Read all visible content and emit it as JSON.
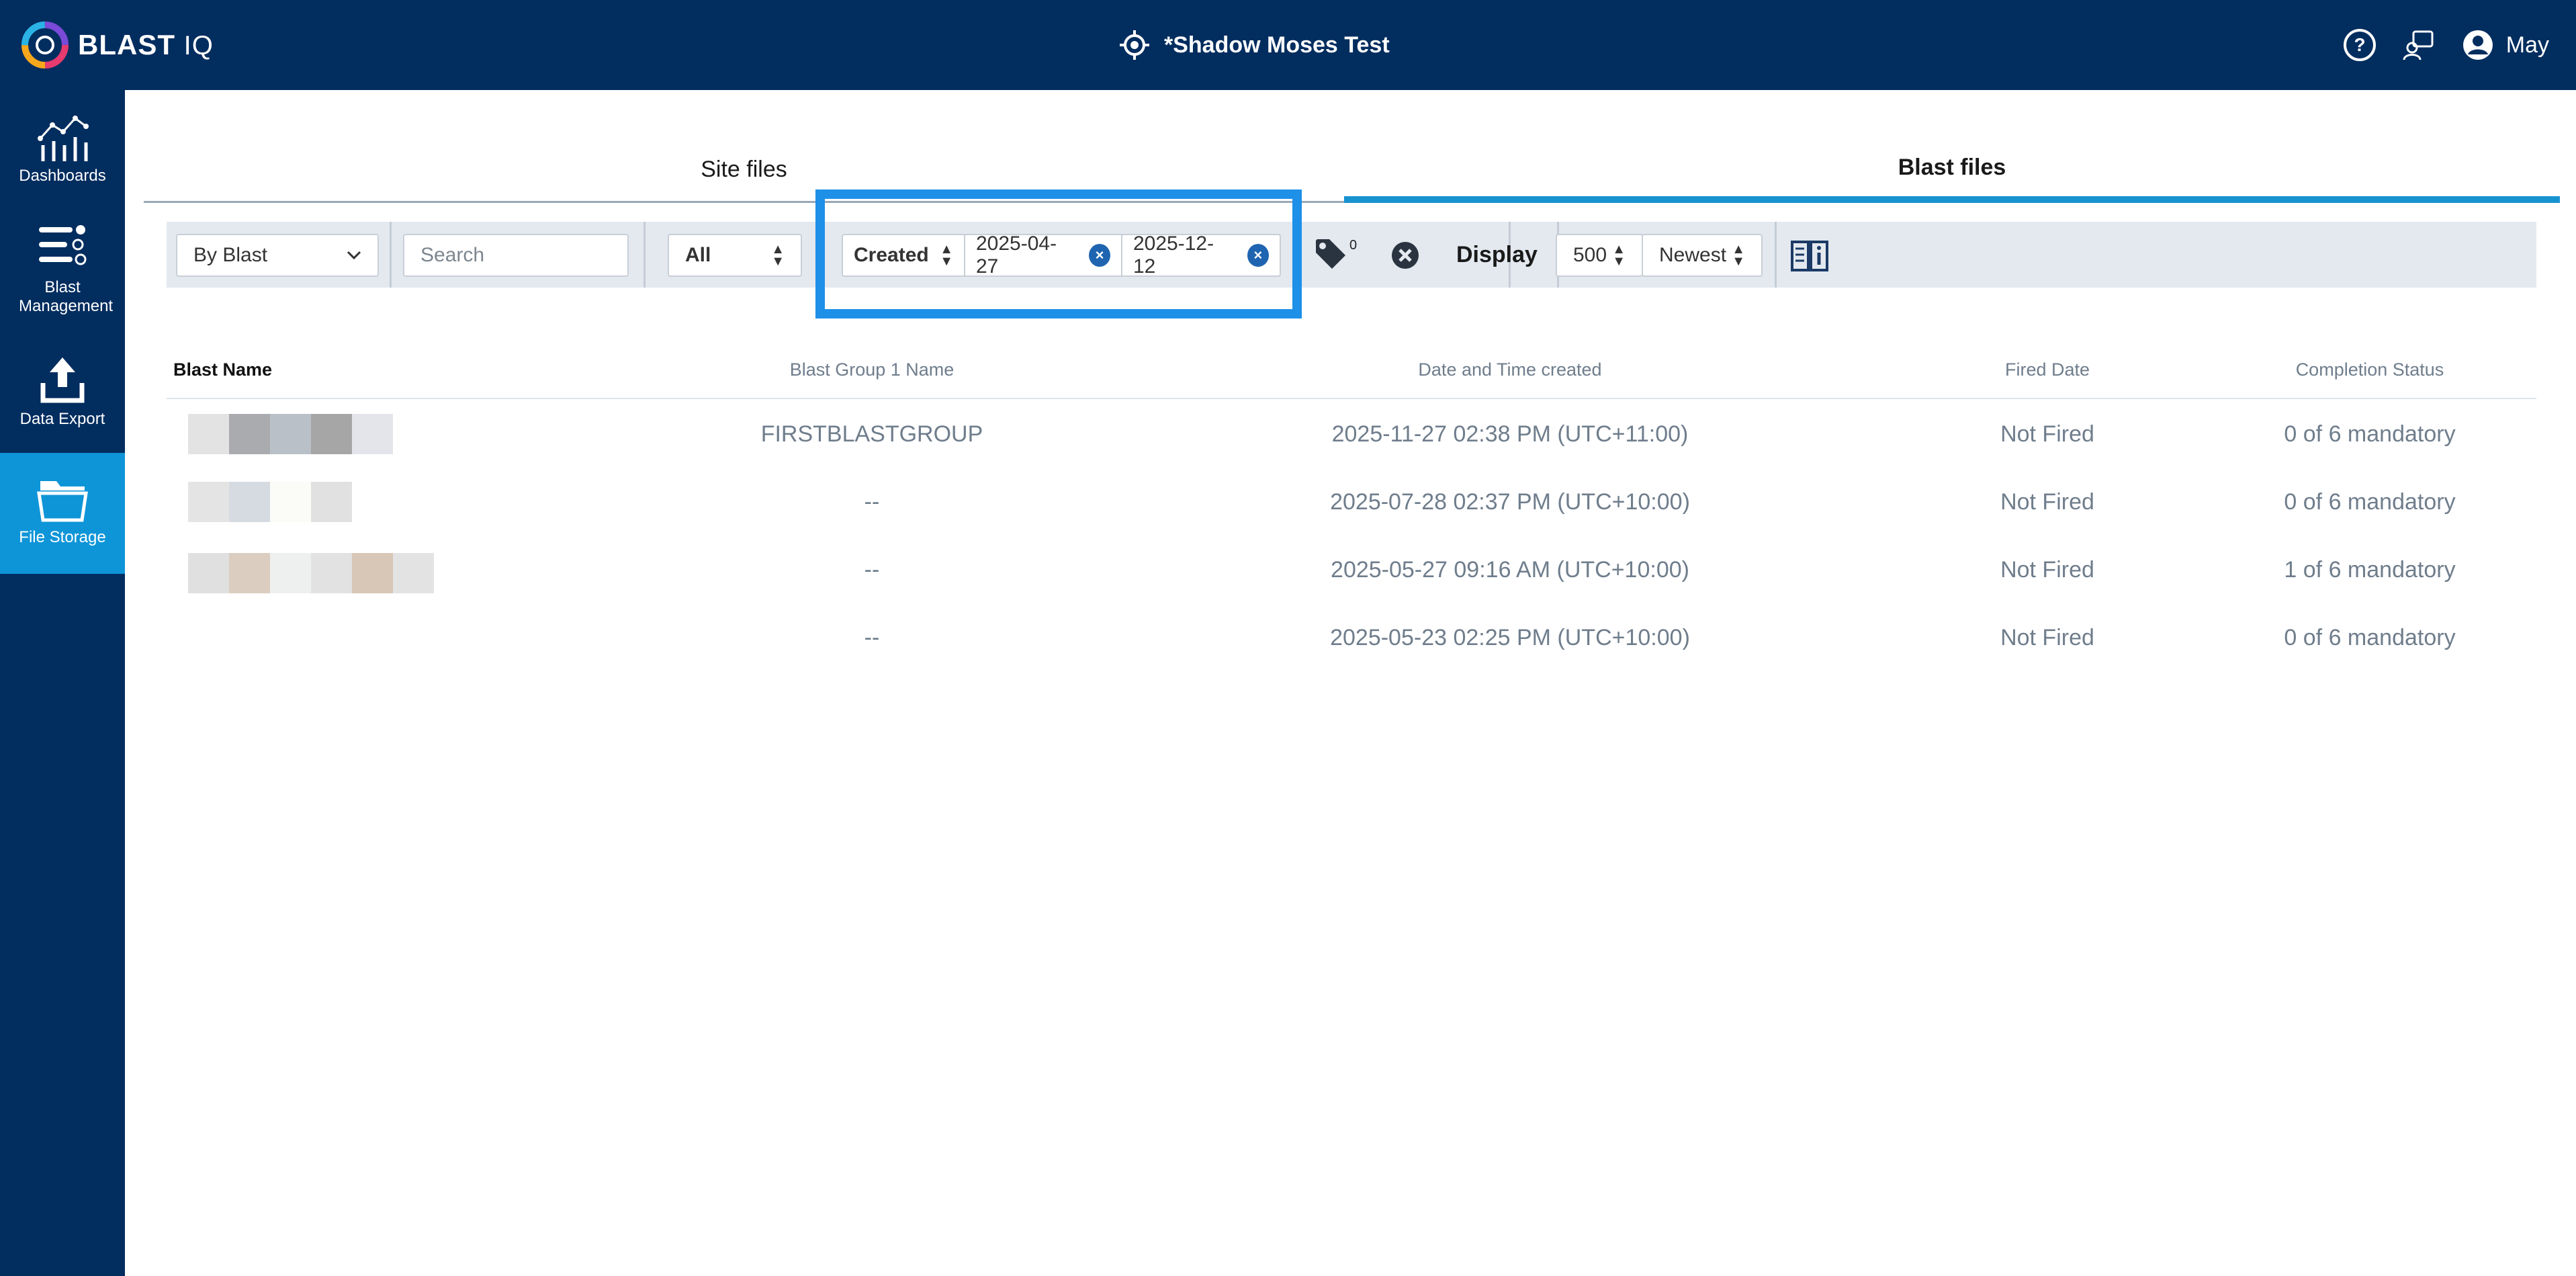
{
  "header": {
    "logo_text": "BLAST",
    "logo_suffix": "IQ",
    "site_title": "*Shadow Moses Test",
    "user_name": "May"
  },
  "sidebar": {
    "items": [
      {
        "label": "Dashboards",
        "icon": "dashboards-icon"
      },
      {
        "label": "Blast Management",
        "icon": "blast-management-icon"
      },
      {
        "label": "Data Export",
        "icon": "upload-icon"
      },
      {
        "label": "File Storage",
        "icon": "folder-icon",
        "active": true
      }
    ]
  },
  "tabs": [
    {
      "label": "Site files",
      "active": false
    },
    {
      "label": "Blast files",
      "active": true
    }
  ],
  "filters": {
    "group_by": "By Blast",
    "search_placeholder": "Search",
    "type_filter": "All",
    "date_field": "Created",
    "date_from": "2025-04-27",
    "date_to": "2025-12-12",
    "tag_count": "0",
    "display_label": "Display",
    "page_size": "500",
    "sort": "Newest"
  },
  "table": {
    "columns": [
      "Blast Name",
      "Blast Group 1 Name",
      "Date and Time created",
      "Fired Date",
      "Completion Status"
    ],
    "rows": [
      {
        "group": "FIRSTBLASTGROUP",
        "created": "2025-11-27 02:38 PM (UTC+11:00)",
        "fired": "Not Fired",
        "status": "0 of 6 mandatory"
      },
      {
        "group": "--",
        "created": "2025-07-28 02:37 PM (UTC+10:00)",
        "fired": "Not Fired",
        "status": "0 of 6 mandatory"
      },
      {
        "group": "--",
        "created": "2025-05-27 09:16 AM (UTC+10:00)",
        "fired": "Not Fired",
        "status": "1 of 6 mandatory"
      },
      {
        "group": "--",
        "created": "2025-05-23 02:25 PM (UTC+10:00)",
        "fired": "Not Fired",
        "status": "0 of 6 mandatory"
      }
    ]
  },
  "colors": {
    "navy": "#022d5f",
    "active_blue": "#0e95d8",
    "highlight": "#1e90e8",
    "clear_dot": "#1f64b0"
  }
}
